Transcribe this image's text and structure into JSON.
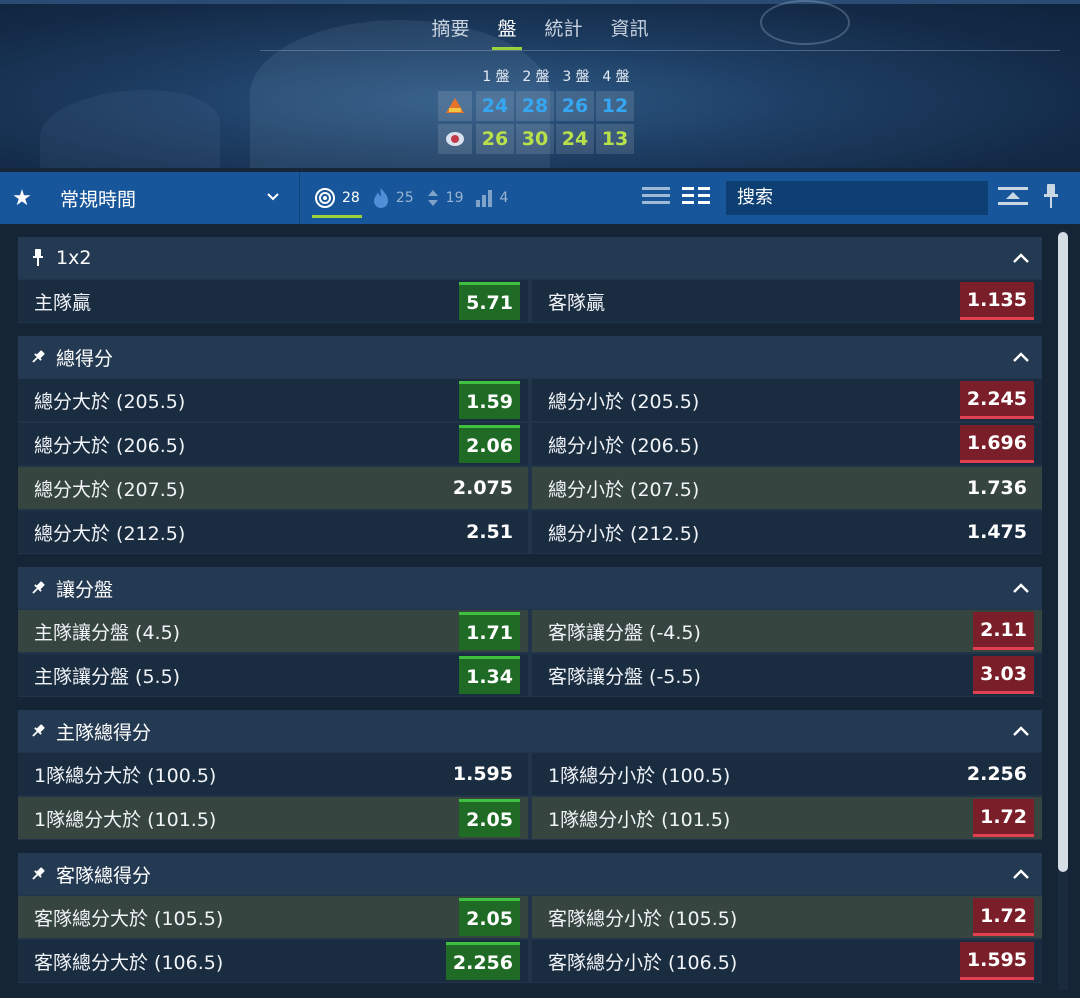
{
  "tabs": [
    "摘要",
    "盤",
    "統計",
    "資訊"
  ],
  "active_tab": "盤",
  "score": {
    "periods": [
      "1 盤",
      "2 盤",
      "3 盤",
      "4 盤"
    ],
    "home": [
      "24",
      "28",
      "26",
      "12"
    ],
    "away": [
      "26",
      "30",
      "24",
      "13"
    ]
  },
  "toolbar": {
    "period_label": "常規時間",
    "filters": [
      {
        "icon": "target-icon",
        "count": "28"
      },
      {
        "icon": "fire-icon",
        "count": "25"
      },
      {
        "icon": "updown-icon",
        "count": "19"
      },
      {
        "icon": "bars-icon",
        "count": "4"
      }
    ],
    "search_placeholder": "搜索"
  },
  "colors": {
    "odds_up": "#1f6b25",
    "odds_down": "#7a1f29",
    "accent": "#9bd23a",
    "toolbar": "#17569a"
  },
  "markets": [
    {
      "title": "1x2",
      "rows": [
        [
          {
            "name": "主隊贏",
            "odd": "5.71",
            "trend": "up"
          },
          {
            "name": "客隊贏",
            "odd": "1.135",
            "trend": "down"
          }
        ]
      ]
    },
    {
      "title": "總得分",
      "rows": [
        [
          {
            "name": "總分大於 (205.5)",
            "odd": "1.59",
            "trend": "up"
          },
          {
            "name": "總分小於 (205.5)",
            "odd": "2.245",
            "trend": "down"
          }
        ],
        [
          {
            "name": "總分大於 (206.5)",
            "odd": "2.06",
            "trend": "up"
          },
          {
            "name": "總分小於 (206.5)",
            "odd": "1.696",
            "trend": "down"
          }
        ],
        [
          {
            "name": "總分大於 (207.5)",
            "odd": "2.075",
            "trend": "plain",
            "hl": true
          },
          {
            "name": "總分小於 (207.5)",
            "odd": "1.736",
            "trend": "plain",
            "hl": true
          }
        ],
        [
          {
            "name": "總分大於 (212.5)",
            "odd": "2.51",
            "trend": "plain"
          },
          {
            "name": "總分小於 (212.5)",
            "odd": "1.475",
            "trend": "plain"
          }
        ]
      ]
    },
    {
      "title": "讓分盤",
      "rows": [
        [
          {
            "name": "主隊讓分盤 (4.5)",
            "odd": "1.71",
            "trend": "up",
            "hl": true
          },
          {
            "name": "客隊讓分盤 (-4.5)",
            "odd": "2.11",
            "trend": "down",
            "hl": true
          }
        ],
        [
          {
            "name": "主隊讓分盤 (5.5)",
            "odd": "1.34",
            "trend": "up"
          },
          {
            "name": "客隊讓分盤 (-5.5)",
            "odd": "3.03",
            "trend": "down"
          }
        ]
      ]
    },
    {
      "title": "主隊總得分",
      "rows": [
        [
          {
            "name": "1隊總分大於 (100.5)",
            "odd": "1.595",
            "trend": "plain"
          },
          {
            "name": "1隊總分小於 (100.5)",
            "odd": "2.256",
            "trend": "plain"
          }
        ],
        [
          {
            "name": "1隊總分大於 (101.5)",
            "odd": "2.05",
            "trend": "up",
            "hl": true
          },
          {
            "name": "1隊總分小於 (101.5)",
            "odd": "1.72",
            "trend": "down",
            "hl": true
          }
        ]
      ]
    },
    {
      "title": "客隊總得分",
      "rows": [
        [
          {
            "name": "客隊總分大於 (105.5)",
            "odd": "2.05",
            "trend": "up",
            "hl": true
          },
          {
            "name": "客隊總分小於 (105.5)",
            "odd": "1.72",
            "trend": "down",
            "hl": true
          }
        ],
        [
          {
            "name": "客隊總分大於 (106.5)",
            "odd": "2.256",
            "trend": "up"
          },
          {
            "name": "客隊總分小於 (106.5)",
            "odd": "1.595",
            "trend": "down"
          }
        ]
      ]
    }
  ]
}
